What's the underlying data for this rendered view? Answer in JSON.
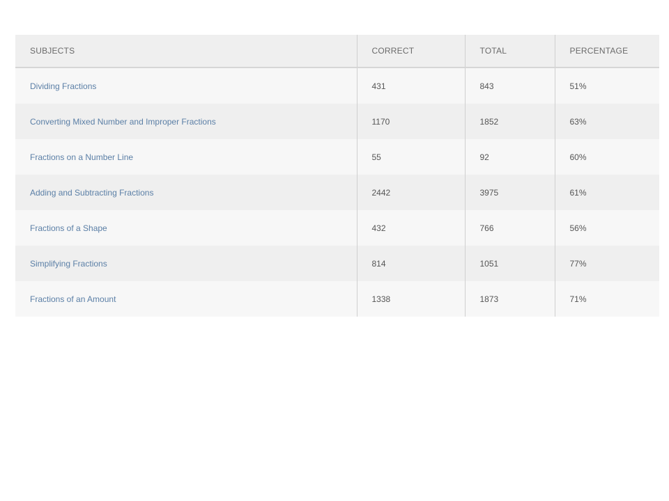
{
  "table": {
    "headers": {
      "subjects": "SUBJECTS",
      "correct": "CORRECT",
      "total": "TOTAL",
      "percentage": "PERCENTAGE"
    },
    "rows": [
      {
        "subject": "Dividing Fractions",
        "correct": "431",
        "total": "843",
        "percentage": "51%"
      },
      {
        "subject": "Converting Mixed Number and Improper Fractions",
        "correct": "1170",
        "total": "1852",
        "percentage": "63%"
      },
      {
        "subject": "Fractions on a Number Line",
        "correct": "55",
        "total": "92",
        "percentage": "60%"
      },
      {
        "subject": "Adding and Subtracting Fractions",
        "correct": "2442",
        "total": "3975",
        "percentage": "61%"
      },
      {
        "subject": "Fractions of a Shape",
        "correct": "432",
        "total": "766",
        "percentage": "56%"
      },
      {
        "subject": "Simplifying Fractions",
        "correct": "814",
        "total": "1051",
        "percentage": "77%"
      },
      {
        "subject": "Fractions of an Amount",
        "correct": "1338",
        "total": "1873",
        "percentage": "71%"
      }
    ]
  },
  "colors": {
    "link": "#5b7fa6",
    "header_bg": "#efefef",
    "row_light": "#f7f7f7",
    "row_dark": "#efefef"
  }
}
